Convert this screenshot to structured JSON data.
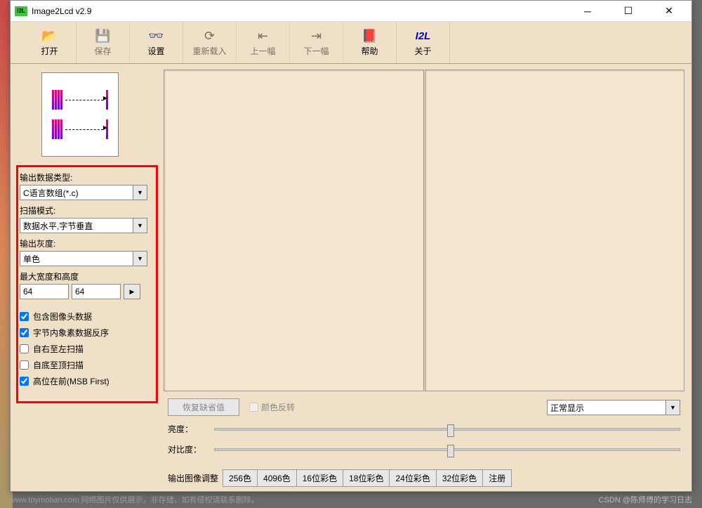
{
  "window": {
    "title": "Image2Lcd v2.9",
    "app_icon_text": "I2L"
  },
  "toolbar": {
    "open": "打开",
    "save": "保存",
    "settings": "设置",
    "reload": "重新载入",
    "prev": "上一幅",
    "next": "下一幅",
    "help": "帮助",
    "about": "关于",
    "about_icon": "I2L"
  },
  "left": {
    "output_type_label": "输出数据类型:",
    "output_type_value": "C语言数组(*.c)",
    "scan_mode_label": "扫描模式:",
    "scan_mode_value": "数据水平,字节垂直",
    "gray_label": "输出灰度:",
    "gray_value": "单色",
    "size_label": "最大宽度和高度",
    "width": "64",
    "height": "64",
    "checks": {
      "include_header": "包含图像头数据",
      "reverse_pixels": "字节内象素数据反序",
      "right_to_left": "自右至左扫描",
      "bottom_to_top": "自底至顶扫描",
      "msb_first": "高位在前(MSB First)"
    }
  },
  "right": {
    "restore_default": "恢复缺省值",
    "invert_color": "颜色反转",
    "display_mode": "正常显示",
    "brightness": "亮度：",
    "contrast": "对比度：",
    "output_adjust": "输出图像调整",
    "tabs": [
      "256色",
      "4096色",
      "16位彩色",
      "18位彩色",
      "24位彩色",
      "32位彩色",
      "注册"
    ]
  },
  "watermark": "CSDN @陈师傅的学习日志",
  "footer": "www.toymoban.com 网络图片仅供展示，非存储，如有侵权请联系删除。"
}
